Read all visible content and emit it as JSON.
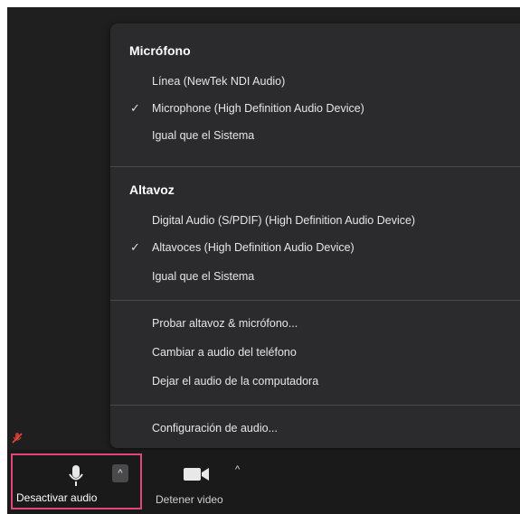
{
  "menu": {
    "microphone": {
      "title": "Micrófono",
      "items": [
        {
          "label": "Línea (NewTek NDI Audio)",
          "checked": false
        },
        {
          "label": "Microphone (High Definition Audio Device)",
          "checked": true
        },
        {
          "label": "Igual que el Sistema",
          "checked": false
        }
      ]
    },
    "speaker": {
      "title": "Altavoz",
      "items": [
        {
          "label": "Digital Audio (S/PDIF) (High Definition Audio Device)",
          "checked": false
        },
        {
          "label": "Altavoces (High Definition Audio Device)",
          "checked": true
        },
        {
          "label": "Igual que el Sistema",
          "checked": false
        }
      ]
    },
    "actions": [
      "Probar altavoz & micrófono...",
      "Cambiar a audio del teléfono",
      "Dejar el audio de la computadora"
    ],
    "settings_label": "Configuración de audio...",
    "check_glyph": "✓"
  },
  "toolbar": {
    "audio_label": "Desactivar audio",
    "video_label": "Detener video",
    "caret_glyph": "^"
  },
  "colors": {
    "highlight_border": "#e0467a",
    "menu_bg": "#2b2b2d",
    "app_bg": "#1f1f1f"
  },
  "icons": {
    "microphone": "microphone-icon",
    "video": "video-camera-icon",
    "muted_indicator": "muted-mic-icon"
  }
}
